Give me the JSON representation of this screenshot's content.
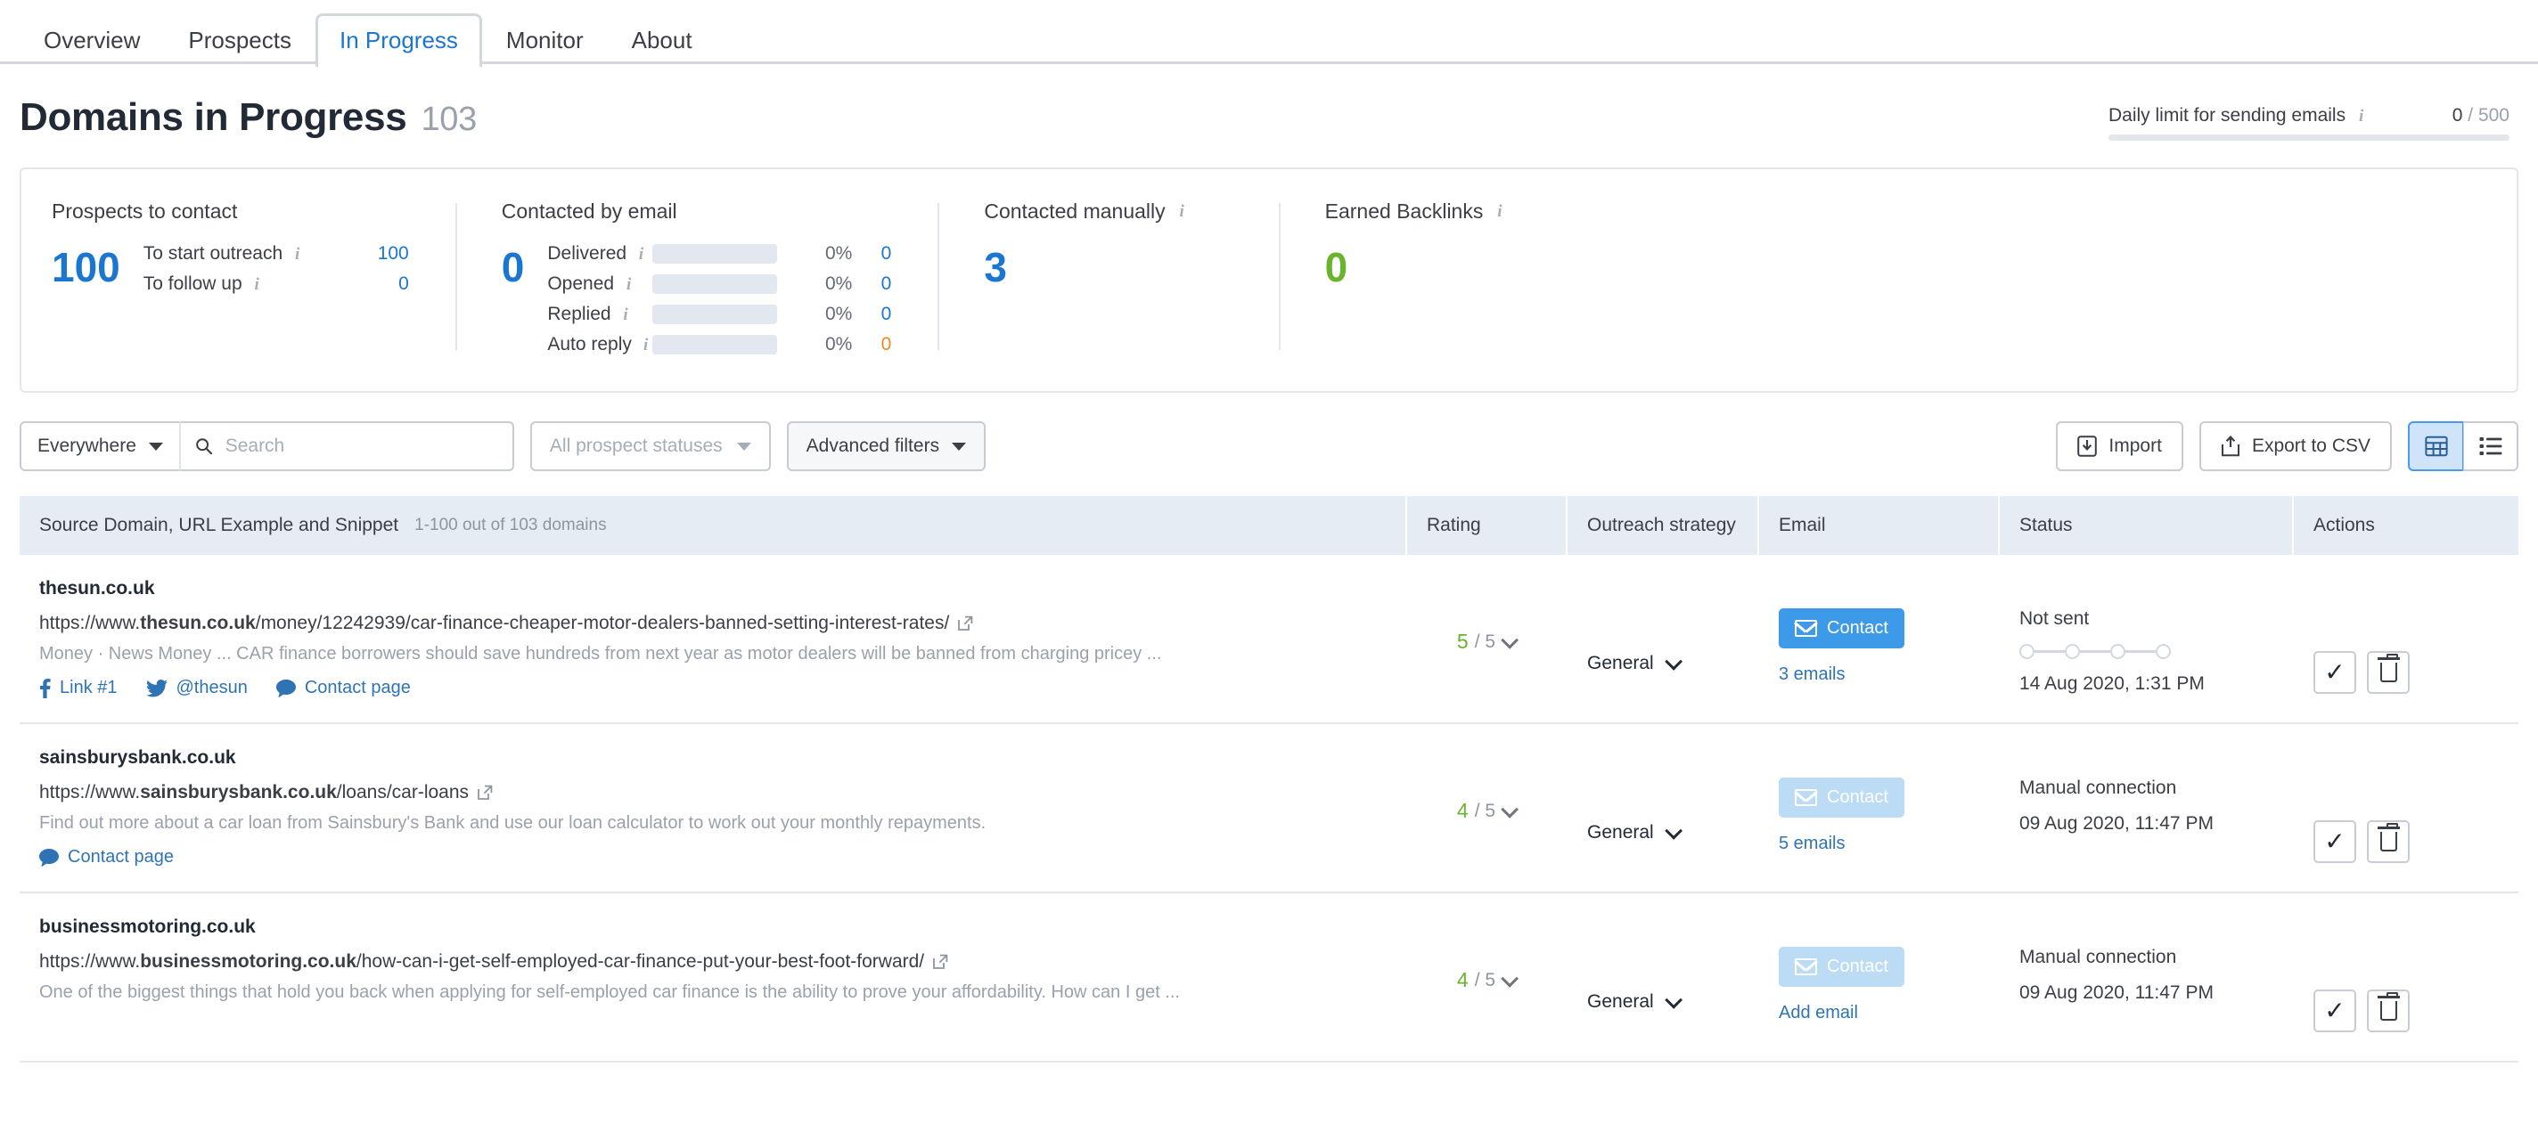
{
  "tabs": [
    {
      "label": "Overview",
      "active": false
    },
    {
      "label": "Prospects",
      "active": false
    },
    {
      "label": "In Progress",
      "active": true
    },
    {
      "label": "Monitor",
      "active": false
    },
    {
      "label": "About",
      "active": false
    }
  ],
  "header": {
    "title": "Domains in Progress",
    "count": "103",
    "daily_limit": {
      "label": "Daily limit for sending emails",
      "current": "0",
      "separator": "/",
      "max": "500",
      "progress_pct": 0
    }
  },
  "summary": {
    "prospects": {
      "title": "Prospects to contact",
      "total": "100",
      "rows": [
        {
          "label": "To start outreach",
          "value": "100"
        },
        {
          "label": "To follow up",
          "value": "0"
        }
      ]
    },
    "contacted_email": {
      "title": "Contacted by email",
      "total": "0",
      "rows": [
        {
          "label": "Delivered",
          "pct": "0%",
          "value": "0",
          "bar_pct": 0,
          "color": "#1b76d2"
        },
        {
          "label": "Opened",
          "pct": "0%",
          "value": "0",
          "bar_pct": 0,
          "color": "#1b76d2"
        },
        {
          "label": "Replied",
          "pct": "0%",
          "value": "0",
          "bar_pct": 0,
          "color": "#1b76d2"
        },
        {
          "label": "Auto reply",
          "pct": "0%",
          "value": "0",
          "bar_pct": 0,
          "color": "#f2871f"
        }
      ]
    },
    "contacted_manual": {
      "title": "Contacted manually",
      "value": "3"
    },
    "earned_backlinks": {
      "title": "Earned Backlinks",
      "value": "0"
    }
  },
  "toolbar": {
    "scope": "Everywhere",
    "search_placeholder": "Search",
    "search_value": "",
    "status_filter": "All prospect statuses",
    "advanced_filters": "Advanced filters",
    "import": "Import",
    "export": "Export to CSV",
    "view_table_active": true
  },
  "table": {
    "columns": {
      "domain": "Source Domain, URL Example and Snippet",
      "domain_sub": "1-100 out of 103 domains",
      "rating": "Rating",
      "strategy": "Outreach strategy",
      "email": "Email",
      "status": "Status",
      "actions": "Actions"
    },
    "rows": [
      {
        "domain": "thesun.co.uk",
        "url_prefix": "https://www.",
        "url_bold": "thesun.co.uk",
        "url_suffix": "/money/12242939/car-finance-cheaper-motor-dealers-banned-setting-interest-rates/",
        "snippet": "Money · News Money ... CAR finance borrowers should save hundreds from next year as motor dealers will be banned from charging pricey ...",
        "links": [
          {
            "icon": "facebook-icon",
            "label": "Link #1"
          },
          {
            "icon": "twitter-icon",
            "label": "@thesun"
          },
          {
            "icon": "contact-page-icon",
            "label": "Contact page"
          }
        ],
        "rating_value": "5",
        "rating_max": "/ 5",
        "strategy": "General",
        "contact_label": "Contact",
        "contact_disabled": false,
        "email_sub": "3 emails",
        "status_text": "Not sent",
        "show_dots": true,
        "dots_total": 4,
        "dots_filled": 0,
        "status_date": "14 Aug 2020, 1:31 PM"
      },
      {
        "domain": "sainsburysbank.co.uk",
        "url_prefix": "https://www.",
        "url_bold": "sainsburysbank.co.uk",
        "url_suffix": "/loans/car-loans",
        "snippet": "Find out more about a car loan from Sainsbury's Bank and use our loan calculator to work out your monthly repayments.",
        "links": [
          {
            "icon": "contact-page-icon",
            "label": "Contact page"
          }
        ],
        "rating_value": "4",
        "rating_max": "/ 5",
        "strategy": "General",
        "contact_label": "Contact",
        "contact_disabled": true,
        "email_sub": "5 emails",
        "status_text": "Manual connection",
        "show_dots": false,
        "dots_total": 0,
        "dots_filled": 0,
        "status_date": "09 Aug 2020, 11:47 PM"
      },
      {
        "domain": "businessmotoring.co.uk",
        "url_prefix": "https://www.",
        "url_bold": "businessmotoring.co.uk",
        "url_suffix": "/how-can-i-get-self-employed-car-finance-put-your-best-foot-forward/",
        "snippet": "One of the biggest things that hold you back when applying for self-employed car finance is the ability to prove your affordability. How can I get ...",
        "links": [],
        "rating_value": "4",
        "rating_max": "/ 5",
        "strategy": "General",
        "contact_label": "Contact",
        "contact_disabled": true,
        "email_sub": "Add email",
        "status_text": "Manual connection",
        "show_dots": false,
        "dots_total": 0,
        "dots_filled": 0,
        "status_date": "09 Aug 2020, 11:47 PM"
      }
    ]
  },
  "colors": {
    "accent_blue": "#1b76d2",
    "link_blue": "#2e74b5",
    "green": "#6ab42c",
    "orange": "#f2871f",
    "header_bg": "#e6ecf3",
    "btn_blue": "#3d9ae8"
  }
}
